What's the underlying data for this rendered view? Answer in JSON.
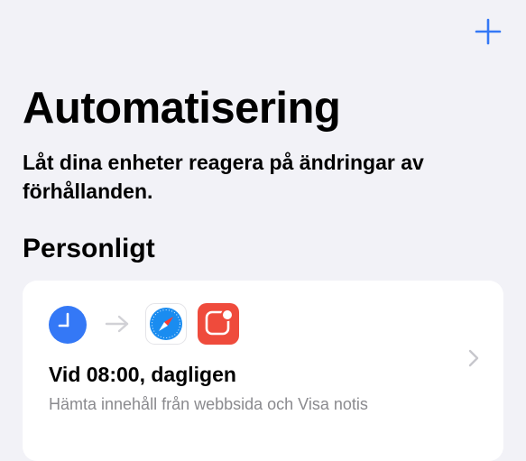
{
  "colors": {
    "background": "#f2f2f7",
    "card": "#ffffff",
    "accent": "#3478f6",
    "secondary_text": "#8a8a8e"
  },
  "toolbar": {
    "add_icon": "plus-icon"
  },
  "header": {
    "title": "Automatisering",
    "subtitle": "Låt dina enheter reagera på ändringar av förhållanden."
  },
  "section": {
    "title": "Personligt"
  },
  "automations": [
    {
      "icons": [
        "clock-icon",
        "arrow-right-icon",
        "safari-icon",
        "reminder-notification-icon"
      ],
      "title": "Vid 08:00, dagligen",
      "description": "Hämta innehåll från webbsida och Visa notis"
    }
  ]
}
